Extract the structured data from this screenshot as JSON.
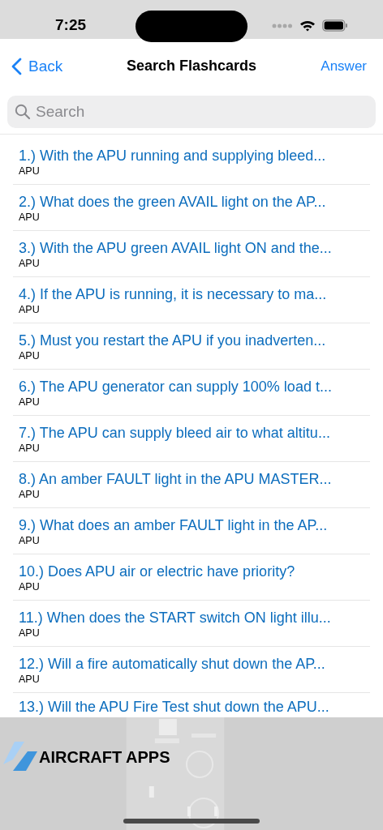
{
  "status_bar": {
    "time": "7:25"
  },
  "nav": {
    "back": "Back",
    "title": "Search Flashcards",
    "action": "Answer"
  },
  "search": {
    "placeholder": "Search"
  },
  "cards": [
    {
      "title": "1.) With the APU running and supplying bleed...",
      "category": "APU"
    },
    {
      "title": "2.) What does the green AVAIL light on the AP...",
      "category": "APU"
    },
    {
      "title": "3.) With the APU green AVAIL light ON and the...",
      "category": "APU"
    },
    {
      "title": "4.) If the APU is running, it is necessary to ma...",
      "category": "APU"
    },
    {
      "title": "5.) Must you restart the APU if you inadverten...",
      "category": "APU"
    },
    {
      "title": "6.) The APU generator can supply 100% load t...",
      "category": "APU"
    },
    {
      "title": "7.) The APU can supply bleed air to what altitu...",
      "category": "APU"
    },
    {
      "title": "8.) An amber FAULT light in the APU MASTER...",
      "category": "APU"
    },
    {
      "title": "9.) What does an amber FAULT light in the AP...",
      "category": "APU"
    },
    {
      "title": "10.) Does APU air or electric have priority?",
      "category": "APU"
    },
    {
      "title": "11.) When does the START switch ON light illu...",
      "category": "APU"
    },
    {
      "title": "12.) Will a fire automatically shut down the AP...",
      "category": "APU"
    },
    {
      "title": "13.) Will the APU Fire Test shut down the APU..."
    }
  ],
  "banner": {
    "brand": "AIRCRAFT APPS"
  }
}
